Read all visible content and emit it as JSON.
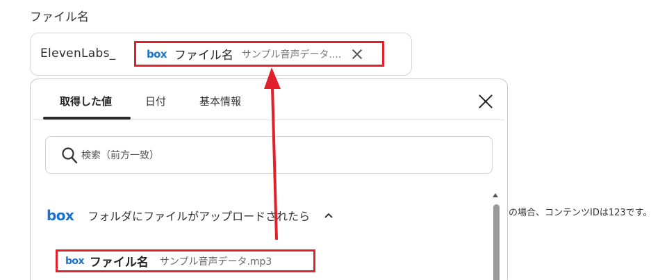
{
  "field": {
    "label": "ファイル名",
    "prefix": "ElevenLabs_",
    "token": {
      "service": "box",
      "label": "ファイル名",
      "value": "サンプル音声データ...."
    }
  },
  "popup": {
    "tabs": [
      {
        "label": "取得した値",
        "active": true
      },
      {
        "label": "日付",
        "active": false
      },
      {
        "label": "基本情報",
        "active": false
      }
    ],
    "search_placeholder": "検索（前方一致）",
    "group": {
      "service": "box",
      "title": "フォルダにファイルがアップロードされたら",
      "expanded": true
    },
    "items": [
      {
        "service": "box",
        "label": "ファイル名",
        "value": "サンプル音声データ.mp3"
      }
    ]
  },
  "background_hint": "の場合、コンテンツIDは123です。",
  "colors": {
    "highlight": "#e0202b",
    "box_brand": "#1a73c9",
    "arrow": "#e0202b"
  },
  "icons": [
    "box-logo",
    "close-icon",
    "search-icon",
    "chevron-up-icon",
    "scroll-up-icon"
  ]
}
